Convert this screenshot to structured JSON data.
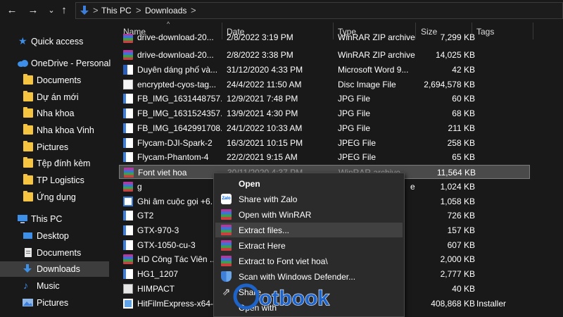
{
  "address": {
    "crumbs": [
      "This PC",
      "Downloads"
    ],
    "separator": ">"
  },
  "nav_buttons": {
    "back": "←",
    "forward": "→",
    "recent": "⌄",
    "up": "↑"
  },
  "nav": {
    "items": [
      {
        "label": "Quick access",
        "icon": "star-icon"
      },
      {
        "label": "OneDrive - Personal",
        "icon": "cloud-icon"
      },
      {
        "label": "Documents",
        "icon": "folder-icon"
      },
      {
        "label": "Dự án mới",
        "icon": "folder-icon"
      },
      {
        "label": "Nha khoa",
        "icon": "folder-icon"
      },
      {
        "label": "Nha khoa Vinh",
        "icon": "folder-icon"
      },
      {
        "label": "Pictures",
        "icon": "folder-icon"
      },
      {
        "label": "Tệp đính kèm",
        "icon": "folder-icon"
      },
      {
        "label": "TP Logistics",
        "icon": "folder-icon"
      },
      {
        "label": "Ứng dụng",
        "icon": "folder-icon"
      },
      {
        "label": "This PC",
        "icon": "computer-icon"
      },
      {
        "label": "Desktop",
        "icon": "desktop-icon"
      },
      {
        "label": "Documents",
        "icon": "document-icon"
      },
      {
        "label": "Downloads",
        "icon": "download-icon"
      },
      {
        "label": "Music",
        "icon": "music-icon"
      },
      {
        "label": "Pictures",
        "icon": "pictures-icon"
      }
    ]
  },
  "columns": {
    "name": "Name",
    "date": "Date",
    "type": "Type",
    "size": "Size",
    "tags": "Tags"
  },
  "files": [
    {
      "name": "drive-download-20...",
      "date": "2/8/2022 3:19 PM",
      "type": "WinRAR ZIP archive",
      "size": "7,299 KB",
      "tags": "",
      "icon": "rar-icon"
    },
    {
      "name": "drive-download-20...",
      "date": "2/8/2022 3:38 PM",
      "type": "WinRAR ZIP archive",
      "size": "14,025 KB",
      "tags": "",
      "icon": "rar-icon"
    },
    {
      "name": "Duyên dáng phố và...",
      "date": "31/12/2020 4:33 PM",
      "type": "Microsoft Word 9...",
      "size": "42 KB",
      "tags": "",
      "icon": "word-icon"
    },
    {
      "name": "encrypted-cyos-tag...",
      "date": "24/4/2022 11:50 AM",
      "type": "Disc Image File",
      "size": "2,694,578 KB",
      "tags": "",
      "icon": "disc-image-icon"
    },
    {
      "name": "FB_IMG_1631448757...",
      "date": "12/9/2021 7:48 PM",
      "type": "JPG File",
      "size": "60 KB",
      "tags": "",
      "icon": "image-icon"
    },
    {
      "name": "FB_IMG_1631524357...",
      "date": "13/9/2021 4:30 PM",
      "type": "JPG File",
      "size": "68 KB",
      "tags": "",
      "icon": "image-icon"
    },
    {
      "name": "FB_IMG_1642991708...",
      "date": "24/1/2022 10:33 AM",
      "type": "JPG File",
      "size": "211 KB",
      "tags": "",
      "icon": "image-icon"
    },
    {
      "name": "Flycam-DJI-Spark-2",
      "date": "16/3/2021 10:15 PM",
      "type": "JPEG File",
      "size": "258 KB",
      "tags": "",
      "icon": "image-icon"
    },
    {
      "name": "Flycam-Phantom-4",
      "date": "22/2/2021 9:15 AM",
      "type": "JPEG File",
      "size": "65 KB",
      "tags": "",
      "icon": "image-icon"
    },
    {
      "name": "Font viet hoa",
      "date": "30/11/2020 4:37 PM",
      "type": "WinRAR archive",
      "size": "11,564 KB",
      "tags": "",
      "icon": "rar-icon"
    },
    {
      "name": "g",
      "date": "",
      "type": "e",
      "size": "1,024 KB",
      "tags": "",
      "icon": "rar-icon"
    },
    {
      "name": "Ghi âm cuộc gọi +6...",
      "date": "",
      "type": "",
      "size": "1,058 KB",
      "tags": "",
      "icon": "audio-icon"
    },
    {
      "name": "GT2",
      "date": "",
      "type": "",
      "size": "726 KB",
      "tags": "",
      "icon": "image-icon"
    },
    {
      "name": "GTX-970-3",
      "date": "",
      "type": "",
      "size": "157 KB",
      "tags": "",
      "icon": "image-icon"
    },
    {
      "name": "GTX-1050-cu-3",
      "date": "",
      "type": "",
      "size": "607 KB",
      "tags": "",
      "icon": "image-icon"
    },
    {
      "name": "HD Công Tác Viên ...",
      "date": "",
      "type": "",
      "size": "2,000 KB",
      "tags": "",
      "icon": "rar-icon"
    },
    {
      "name": "HG1_1207",
      "date": "",
      "type": "",
      "size": "2,777 KB",
      "tags": "",
      "icon": "image-icon"
    },
    {
      "name": "HIMPACT",
      "date": "",
      "type": "",
      "size": "40 KB",
      "tags": "",
      "icon": "app-icon"
    },
    {
      "name": "HitFilmExpress-x64-...",
      "date": "",
      "type": "",
      "size": "408,868 KB",
      "tags": "Installer",
      "icon": "installer-icon"
    }
  ],
  "context_menu": {
    "items": [
      {
        "label": "Open",
        "icon": "",
        "bold": true
      },
      {
        "label": "Share with Zalo",
        "icon": "zalo-icon"
      },
      {
        "label": "Open with WinRAR",
        "icon": "winrar-icon"
      },
      {
        "label": "Extract files...",
        "icon": "winrar-icon"
      },
      {
        "label": "Extract Here",
        "icon": "winrar-icon"
      },
      {
        "label": "Extract to Font viet hoa\\",
        "icon": "winrar-icon"
      },
      {
        "label": "Scan with Windows Defender...",
        "icon": "defender-shield-icon"
      },
      {
        "label": "Share",
        "icon": "share-icon"
      },
      {
        "label": "Open with",
        "icon": ""
      }
    ],
    "zalo_badge": "Zalo"
  },
  "watermark": {
    "text": "otbook"
  },
  "colors": {
    "background": "#191919",
    "selected_row": "#4a4a4a",
    "menu_bg": "#2b2b2b",
    "menu_hover": "#414141",
    "watermark_blue": "#1e63c8",
    "folder_yellow": "#f5c542",
    "accent_blue": "#3d7edb"
  }
}
